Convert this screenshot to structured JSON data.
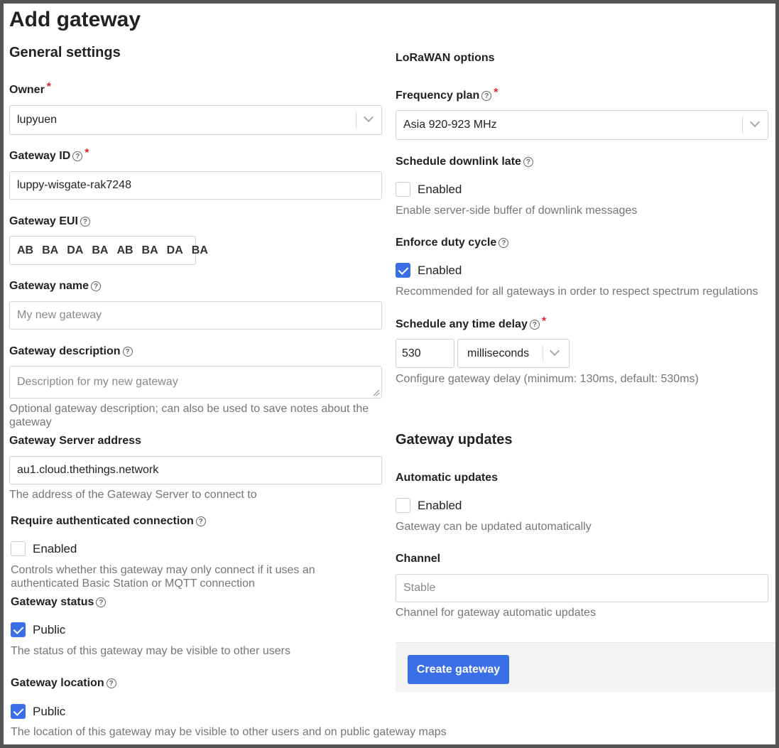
{
  "page": {
    "title": "Add gateway"
  },
  "general": {
    "heading": "General settings",
    "owner": {
      "label": "Owner",
      "value": "lupyuen"
    },
    "gateway_id": {
      "label": "Gateway ID",
      "value": "luppy-wisgate-rak7248"
    },
    "gateway_eui": {
      "label": "Gateway EUI",
      "bytes": [
        "AB",
        "BA",
        "DA",
        "BA",
        "AB",
        "BA",
        "DA",
        "BA"
      ]
    },
    "gateway_name": {
      "label": "Gateway name",
      "placeholder": "My new gateway"
    },
    "gateway_description": {
      "label": "Gateway description",
      "placeholder": "Description for my new gateway",
      "help": "Optional gateway description; can also be used to save notes about the gateway"
    },
    "server_address": {
      "label": "Gateway Server address",
      "value": "au1.cloud.thethings.network",
      "help": "The address of the Gateway Server to connect to"
    },
    "require_auth": {
      "label": "Require authenticated connection",
      "checkbox_label": "Enabled",
      "checked": false,
      "help": "Controls whether this gateway may only connect if it uses an authenticated Basic Station or MQTT connection"
    },
    "gateway_status": {
      "label": "Gateway status",
      "checkbox_label": "Public",
      "checked": true,
      "help": "The status of this gateway may be visible to other users"
    },
    "gateway_location": {
      "label": "Gateway location",
      "checkbox_label": "Public",
      "checked": true,
      "help": "The location of this gateway may be visible to other users and on public gateway maps"
    }
  },
  "lorawan": {
    "heading": "LoRaWAN options",
    "frequency_plan": {
      "label": "Frequency plan",
      "value": "Asia 920-923 MHz"
    },
    "schedule_downlink_late": {
      "label": "Schedule downlink late",
      "checkbox_label": "Enabled",
      "checked": false,
      "help": "Enable server-side buffer of downlink messages"
    },
    "enforce_duty_cycle": {
      "label": "Enforce duty cycle",
      "checkbox_label": "Enabled",
      "checked": true,
      "help": "Recommended for all gateways in order to respect spectrum regulations"
    },
    "schedule_any_time_delay": {
      "label": "Schedule any time delay",
      "value": "530",
      "unit": "milliseconds",
      "help": "Configure gateway delay (minimum: 130ms, default: 530ms)"
    }
  },
  "updates": {
    "heading": "Gateway updates",
    "automatic_updates": {
      "label": "Automatic updates",
      "checkbox_label": "Enabled",
      "checked": false,
      "help": "Gateway can be updated automatically"
    },
    "channel": {
      "label": "Channel",
      "placeholder": "Stable",
      "help": "Channel for gateway automatic updates"
    }
  },
  "actions": {
    "create_label": "Create gateway"
  },
  "icons": {
    "help": "help-circle-icon",
    "chevron": "chevron-down-icon",
    "check": "check-icon"
  },
  "colors": {
    "primary": "#3a6fe8",
    "required": "#db2828",
    "muted": "#767676"
  }
}
